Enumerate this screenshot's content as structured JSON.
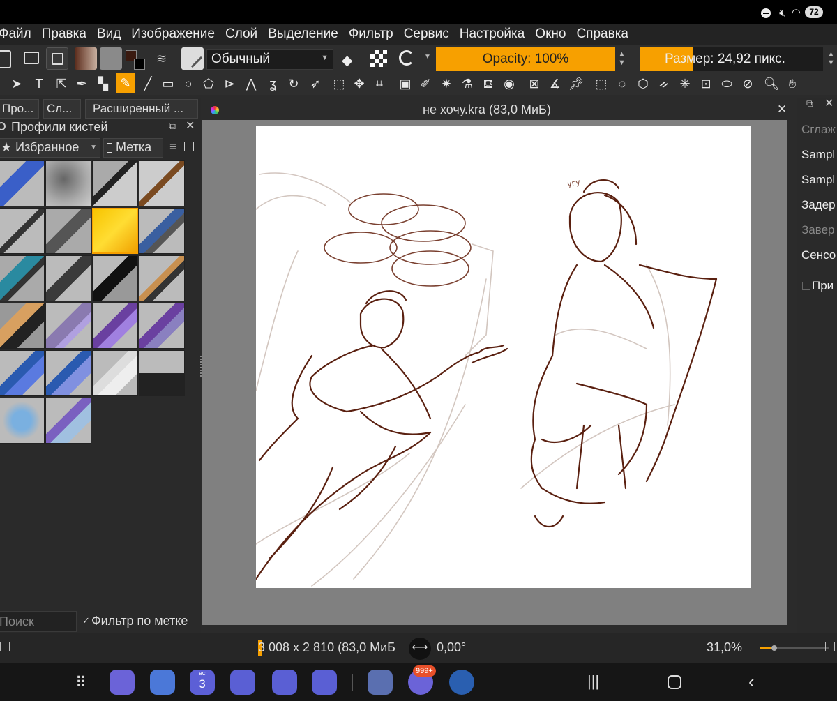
{
  "status_bar": {
    "battery": "72"
  },
  "menu": [
    "Файл",
    "Правка",
    "Вид",
    "Изображение",
    "Слой",
    "Выделение",
    "Фильтр",
    "Сервис",
    "Настройка",
    "Окно",
    "Справка"
  ],
  "tool_options": {
    "blend_mode": "Обычный",
    "opacity_label": "Opacity: 100%",
    "size_label": "Размер: 24,92 пикс.",
    "foreground_color": "#3a1a10",
    "background_color": "#000000",
    "opacity_color": "#f7a000"
  },
  "left_docker": {
    "tabs": [
      "Про...",
      "Сл...",
      "Расширенный ..."
    ],
    "title": "Профили кистей",
    "tag_dropdown": "★ Избранное",
    "tag_button": "Метка",
    "search_placeholder": "Поиск",
    "filter_checkbox": "Фильтр по метке",
    "selected_brush_index": 6
  },
  "document": {
    "tab_title": "не хочу.kra (83,0 МиБ)",
    "sketch_note": "угу"
  },
  "right_docker": {
    "items": [
      "Сглаж",
      "Sampl",
      "Sampl",
      "Задер",
      "Завер",
      "Сенсо",
      "При"
    ]
  },
  "bottom_status": {
    "image_size": "3 008 x 2 810 (83,0 МиБ",
    "rotation": "0,00°",
    "zoom": "31,0%"
  },
  "navbar": {
    "calendar_day": "3",
    "calendar_label": "ВС",
    "telegram_badge": "999+"
  }
}
